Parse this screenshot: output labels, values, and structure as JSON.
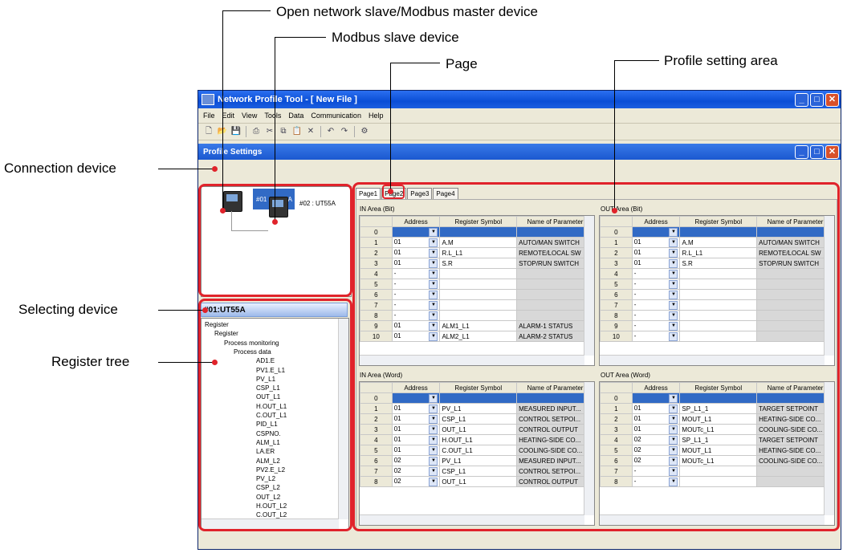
{
  "callouts": {
    "open_network": "Open network slave/Modbus master device",
    "modbus_slave": "Modbus slave device",
    "page": "Page",
    "profile_area": "Profile setting area",
    "connection_device": "Connection device",
    "selecting_device": "Selecting device",
    "register_tree": "Register tree"
  },
  "window": {
    "title": "Network Profile Tool - [ New File ]"
  },
  "menu": [
    "File",
    "Edit",
    "View",
    "Tools",
    "Data",
    "Communication",
    "Help"
  ],
  "subwindow": {
    "title": "Profile Settings"
  },
  "devices": {
    "dev1": "#01 : UT55A",
    "dev2": "#02 : UT55A"
  },
  "selected_device": "#01:UT55A",
  "tree": [
    "Register",
    "Register",
    "Process monitoring",
    "Process data",
    "AD1.E",
    "PV1.E_L1",
    "PV_L1",
    "CSP_L1",
    "OUT_L1",
    "H.OUT_L1",
    "C.OUT_L1",
    "PID_L1",
    "CSPNO.",
    "ALM_L1",
    "LA.ER",
    "ALM_L2",
    "PV2.E_L2",
    "PV_L2",
    "CSP_L2",
    "OUT_L2",
    "H.OUT_L2",
    "C.OUT_L2"
  ],
  "tabs": [
    "Page1",
    "Page2",
    "Page3",
    "Page4"
  ],
  "areas": {
    "in_bit": {
      "title": "IN Area (Bit)",
      "headers": [
        "Address",
        "Register Symbol",
        "Name of Parameter"
      ],
      "rows": [
        [
          "0",
          "",
          "",
          ""
        ],
        [
          "1",
          "01",
          "A.M",
          "AUTO/MAN SWITCH"
        ],
        [
          "2",
          "01",
          "R.L_L1",
          "REMOTE/LOCAL SW"
        ],
        [
          "3",
          "01",
          "S.R",
          "STOP/RUN SWITCH"
        ],
        [
          "4",
          "-",
          "",
          ""
        ],
        [
          "5",
          "-",
          "",
          ""
        ],
        [
          "6",
          "-",
          "",
          ""
        ],
        [
          "7",
          "-",
          "",
          ""
        ],
        [
          "8",
          "-",
          "",
          ""
        ],
        [
          "9",
          "01",
          "ALM1_L1",
          "ALARM-1 STATUS"
        ],
        [
          "10",
          "01",
          "ALM2_L1",
          "ALARM-2 STATUS"
        ]
      ]
    },
    "out_bit": {
      "title": "OUT Area (Bit)",
      "headers": [
        "Address",
        "Register Symbol",
        "Name of Parameter"
      ],
      "rows": [
        [
          "0",
          "",
          "",
          ""
        ],
        [
          "1",
          "01",
          "A.M",
          "AUTO/MAN SWITCH"
        ],
        [
          "2",
          "01",
          "R.L_L1",
          "REMOTE/LOCAL SW"
        ],
        [
          "3",
          "01",
          "S.R",
          "STOP/RUN SWITCH"
        ],
        [
          "4",
          "-",
          "",
          ""
        ],
        [
          "5",
          "-",
          "",
          ""
        ],
        [
          "6",
          "-",
          "",
          ""
        ],
        [
          "7",
          "-",
          "",
          ""
        ],
        [
          "8",
          "-",
          "",
          ""
        ],
        [
          "9",
          "-",
          "",
          ""
        ],
        [
          "10",
          "-",
          "",
          ""
        ]
      ]
    },
    "in_word": {
      "title": "IN Area (Word)",
      "headers": [
        "Address",
        "Register Symbol",
        "Name of Parameter"
      ],
      "rows": [
        [
          "0",
          "",
          "",
          ""
        ],
        [
          "1",
          "01",
          "PV_L1",
          "MEASURED INPUT..."
        ],
        [
          "2",
          "01",
          "CSP_L1",
          "CONTROL SETPOI..."
        ],
        [
          "3",
          "01",
          "OUT_L1",
          "CONTROL OUTPUT"
        ],
        [
          "4",
          "01",
          "H.OUT_L1",
          "HEATING-SIDE CO..."
        ],
        [
          "5",
          "01",
          "C.OUT_L1",
          "COOLING-SIDE CO..."
        ],
        [
          "6",
          "02",
          "PV_L1",
          "MEASURED INPUT..."
        ],
        [
          "7",
          "02",
          "CSP_L1",
          "CONTROL SETPOI..."
        ],
        [
          "8",
          "02",
          "OUT_L1",
          "CONTROL OUTPUT"
        ]
      ]
    },
    "out_word": {
      "title": "OUT Area (Word)",
      "headers": [
        "Address",
        "Register Symbol",
        "Name of Parameter"
      ],
      "rows": [
        [
          "0",
          "",
          "",
          ""
        ],
        [
          "1",
          "01",
          "SP_L1_1",
          "TARGET SETPOINT"
        ],
        [
          "2",
          "01",
          "MOUT_L1",
          "HEATING-SIDE CO..."
        ],
        [
          "3",
          "01",
          "MOUTc_L1",
          "COOLING-SIDE CO..."
        ],
        [
          "4",
          "02",
          "SP_L1_1",
          "TARGET SETPOINT"
        ],
        [
          "5",
          "02",
          "MOUT_L1",
          "HEATING-SIDE CO..."
        ],
        [
          "6",
          "02",
          "MOUTc_L1",
          "COOLING-SIDE CO..."
        ],
        [
          "7",
          "-",
          "",
          ""
        ],
        [
          "8",
          "-",
          "",
          ""
        ]
      ]
    }
  }
}
